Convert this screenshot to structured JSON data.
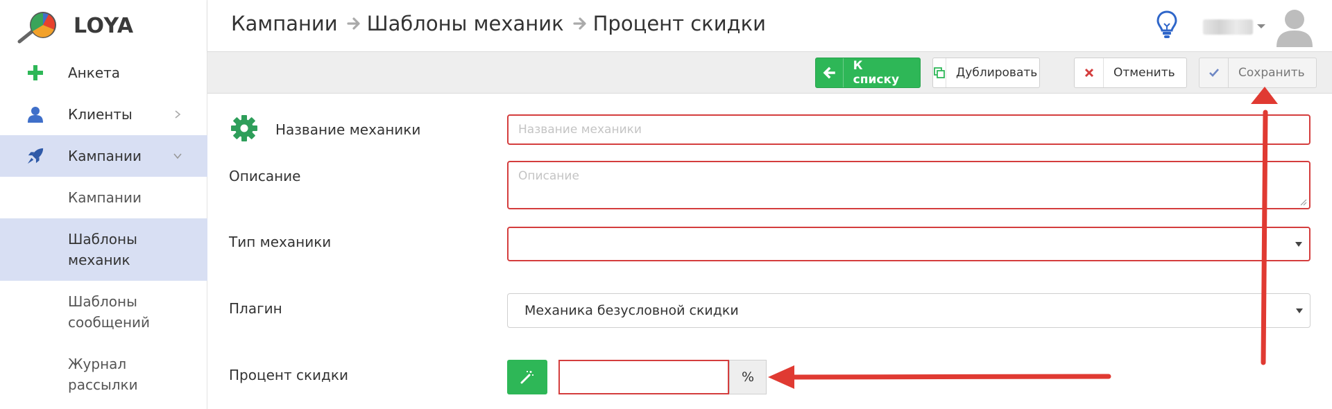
{
  "app": {
    "logo_text": "LOYA"
  },
  "sidebar": {
    "items": [
      {
        "label": "Анкета"
      },
      {
        "label": "Клиенты"
      },
      {
        "label": "Кампании"
      }
    ],
    "sub_items": [
      {
        "label": "Кампании"
      },
      {
        "label": "Шаблоны\nмеханик"
      },
      {
        "label": "Шаблоны\nсообщений"
      },
      {
        "label": "Журнал\nрассылки"
      }
    ]
  },
  "header": {
    "breadcrumb": [
      "Кампании",
      "Шаблоны механик",
      "Процент скидки"
    ]
  },
  "toolbar": {
    "back_label": "К списку",
    "duplicate_label": "Дублировать",
    "cancel_label": "Отменить",
    "save_label": "Сохранить"
  },
  "form": {
    "name_label": "Название механики",
    "name_placeholder": "Название механики",
    "name_value": "",
    "description_label": "Описание",
    "description_placeholder": "Описание",
    "description_value": "",
    "type_label": "Тип механики",
    "type_value": "",
    "plugin_label": "Плагин",
    "plugin_value": "Механика безусловной скидки",
    "percent_label": "Процент скидки",
    "percent_value": "",
    "percent_addon": "%"
  },
  "icons": {
    "anketa": "plus-icon",
    "clients": "user-icon",
    "campaigns": "rocket-icon",
    "back": "arrow-left-icon",
    "duplicate": "copy-icon",
    "cancel": "close-icon",
    "save": "check-icon",
    "settings": "gear-icon",
    "generate": "magic-wand-icon",
    "hint": "lightbulb-icon"
  },
  "colors": {
    "accent_green": "#2eb757",
    "error_red": "#d43d3d",
    "active_nav": "#d8dff3",
    "annotation_red": "#e03a32"
  }
}
